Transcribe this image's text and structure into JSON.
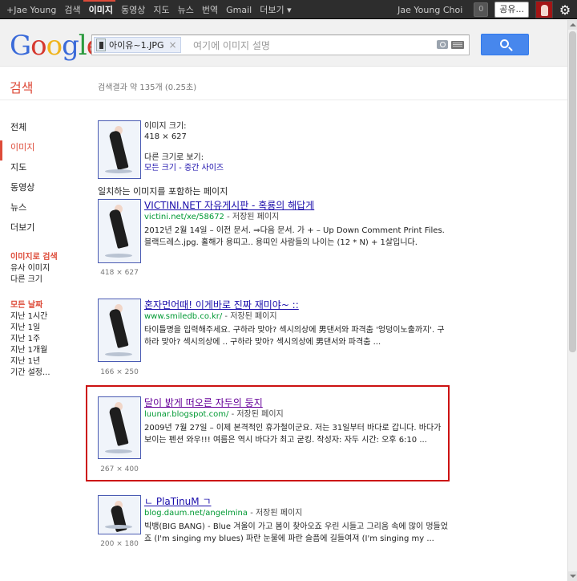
{
  "topbar": {
    "nav": [
      "+Jae Young",
      "검색",
      "이미지",
      "동영상",
      "지도",
      "뉴스",
      "번역",
      "Gmail",
      "더보기 ▾"
    ],
    "active_index": 2,
    "user_name": "Jae Young Choi",
    "notification_count": "0",
    "share_label": "공유..."
  },
  "search": {
    "query_chip": "아이유~1.JPG",
    "placeholder": "여기에 이미지 설명"
  },
  "page": {
    "section_title": "검색",
    "result_stats": "검색결과 약 135개 (0.25초)"
  },
  "leftnav": {
    "items": [
      "전체",
      "이미지",
      "지도",
      "동영상",
      "뉴스",
      "더보기"
    ],
    "active_index": 1,
    "image_search_head": "이미지로 검색",
    "image_search_links": [
      "유사 이미지",
      "다른 크기"
    ],
    "date_head": "모든 날짜",
    "date_links": [
      "지난 1시간",
      "지난 1일",
      "지난 1주",
      "지난 1개월",
      "지난 1년",
      "기간 설정..."
    ]
  },
  "image_info": {
    "size_label": "이미지 크기:",
    "size_value": "418 × 627",
    "other_sizes_label": "다른 크기로 보기:",
    "other_sizes_links": "모든 크기 - 중간 사이즈"
  },
  "matching_title": "일치하는 이미지를 포함하는 페이지",
  "results": [
    {
      "title": "VICTINI.NET 자유게시판 - 혹룡의 해답게",
      "url": "victini.net/xe/58672",
      "cache": " - 저장된 페이지",
      "snippet": "2012년 2월 14일 – 이전 문서. ⇒다음 문서. 가 + – Up Down Comment Print Files. 블랙드레스.jpg. 홀해가 용띠고.. 용띠인 사람들의 나이는 (12 * N) + 1살입니다.",
      "dims": "418 × 627",
      "visited": false
    },
    {
      "title": "혼자먼어때! 이게바로 진짜 재미야~ ::",
      "url": "www.smiledb.co.kr/",
      "cache": " - 저장된 페이지",
      "snippet": "타이틀명을 입력해주세요. 구하라 맞아? 섹시의상에 男댄서와 파격춤 '엉덩이노출까지'. 구하라 맞아? 섹시의상에 .. 구하라 맞아? 섹시의상에 男댄서와 파격춤 ...",
      "dims": "166 × 250",
      "visited": false
    },
    {
      "title": "달이 밝게 떠오른 자두의 둥지",
      "url": "luunar.blogspot.com/",
      "cache": " - 저장된 페이지",
      "snippet": "2009년 7월 27일 – 이제 본격적인 휴가철이군요. 저는 31일부터 바다로 갑니다. 바다가 보이는 펜션 와우!!! 여름은 역시 바다가 최고 굳킹. 작성자: 자두 시간: 오후 6:10 ...",
      "dims": "267 × 400",
      "visited": true
    },
    {
      "title": "ㄴ PlaTinuM ㄱ",
      "url": "blog.daum.net/angelmina",
      "cache": " - 저장된 페이지",
      "snippet": "빅뱅(BIG BANG) - Blue 겨울이 가고 봄이 찾아오죠 우린 시들고 그리움 속에 많이 멍들었죠 (I'm singing my blues) 파란 눈물에 파란 슬픔에 길들여져 (I'm singing my ...",
      "dims": "200 × 180",
      "visited": false
    }
  ],
  "colors": {
    "accent_red": "#dd4b39",
    "link_blue": "#1a0dab",
    "url_green": "#093",
    "highlight_red": "#cc1111",
    "search_button": "#4787ed"
  }
}
